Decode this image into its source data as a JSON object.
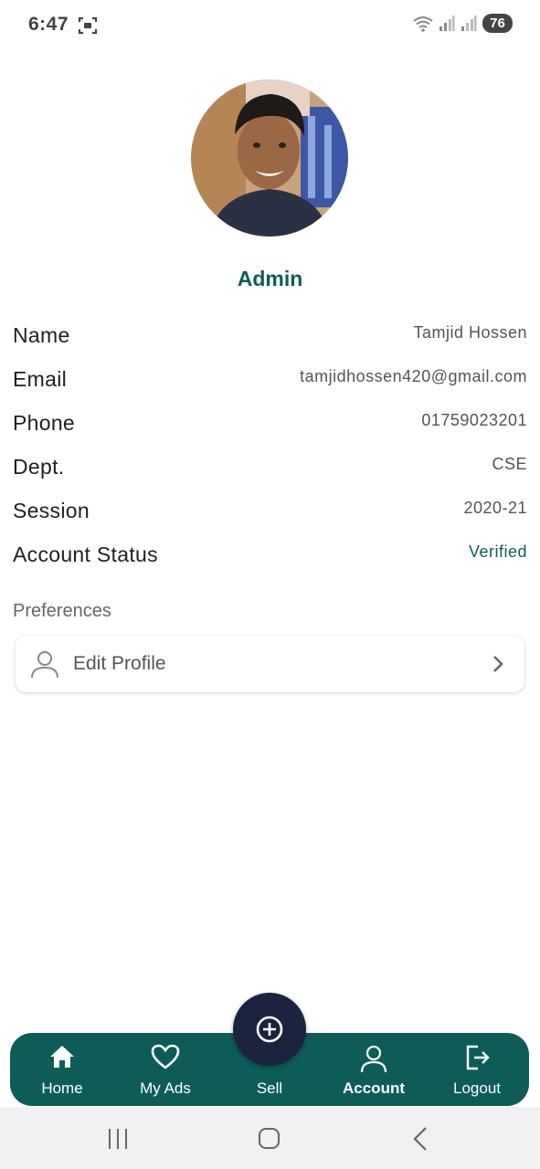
{
  "status_bar": {
    "time": "6:47",
    "battery": "76",
    "icons": [
      "screenshot-icon",
      "wifi-icon",
      "signal-icon",
      "signal-icon"
    ]
  },
  "profile": {
    "role": "Admin",
    "avatar": "profile-photo"
  },
  "info": [
    {
      "label": "Name",
      "value": "Tamjid Hossen"
    },
    {
      "label": "Email",
      "value": "tamjidhossen420@gmail.com"
    },
    {
      "label": "Phone",
      "value": "01759023201"
    },
    {
      "label": "Dept.",
      "value": "CSE"
    },
    {
      "label": "Session",
      "value": "2020-21"
    },
    {
      "label": "Account Status",
      "value": "Verified"
    }
  ],
  "preferences": {
    "heading": "Preferences",
    "edit_profile": "Edit Profile"
  },
  "bottom_nav": {
    "items": [
      {
        "label": "Home",
        "icon": "home-icon"
      },
      {
        "label": "My Ads",
        "icon": "heart-icon"
      },
      {
        "label": "Sell",
        "icon": "plus-circle-icon"
      },
      {
        "label": "Account",
        "icon": "person-icon"
      },
      {
        "label": "Logout",
        "icon": "logout-icon"
      }
    ],
    "active": "Account"
  },
  "colors": {
    "primary": "#0e5c58",
    "fab": "#1c2340",
    "verified": "#0e5c58"
  }
}
